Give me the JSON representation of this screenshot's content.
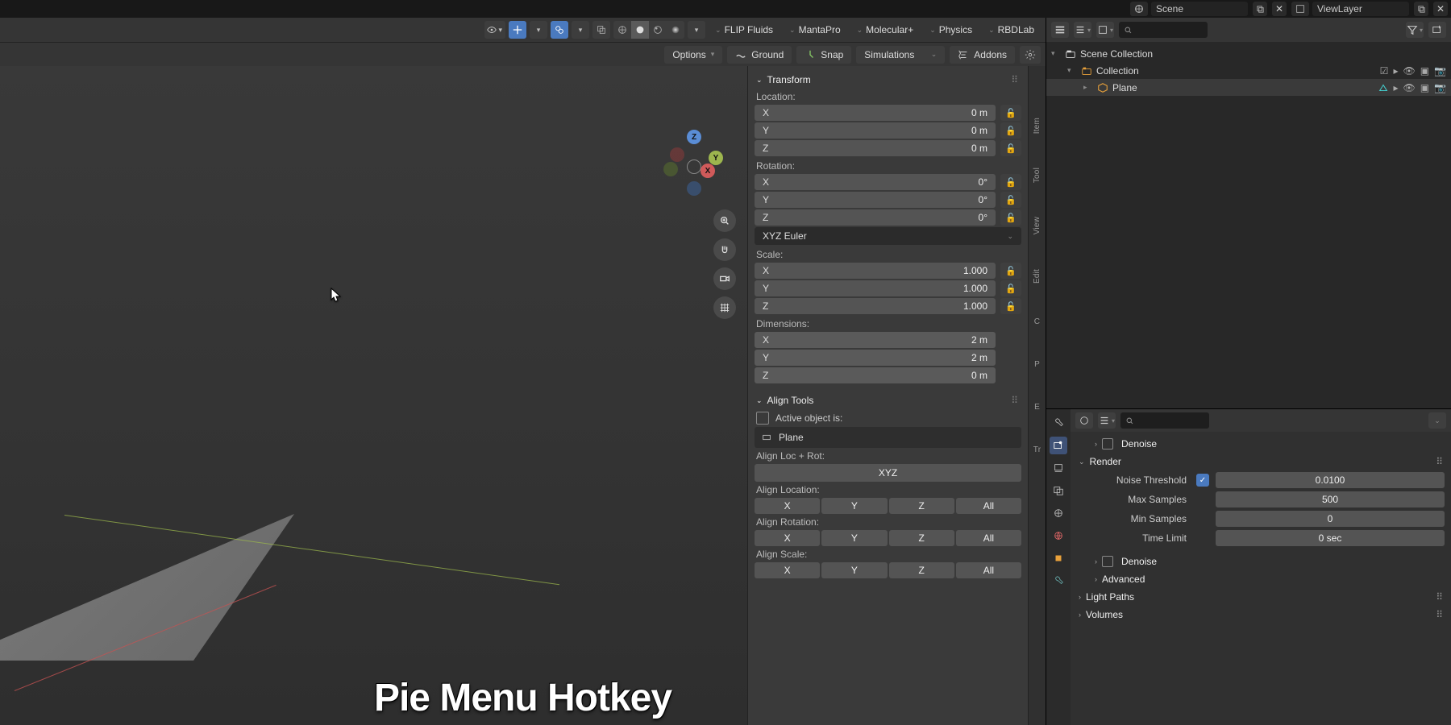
{
  "topbar": {
    "scene_label": "Scene",
    "scene_icon": "scene-icon",
    "layer_label": "ViewLayer",
    "layer_icon": "viewlayer-icon"
  },
  "viewport_header": {
    "menus": [
      "FLIP Fluids",
      "MantaPro",
      "Molecular+",
      "Physics",
      "RBDLab"
    ]
  },
  "viewport_subheader": {
    "options": "Options",
    "ground": "Ground",
    "snap": "Snap",
    "simulations": "Simulations",
    "addons": "Addons"
  },
  "gizmo": {
    "x": "X",
    "y": "Y",
    "z": "Z"
  },
  "npanel": {
    "transform_title": "Transform",
    "location_label": "Location:",
    "rotation_label": "Rotation:",
    "scale_label": "Scale:",
    "dimensions_label": "Dimensions:",
    "rot_mode": "XYZ Euler",
    "loc": {
      "x": "X",
      "xv": "0 m",
      "y": "Y",
      "yv": "0 m",
      "z": "Z",
      "zv": "0 m"
    },
    "rot": {
      "x": "X",
      "xv": "0°",
      "y": "Y",
      "yv": "0°",
      "z": "Z",
      "zv": "0°"
    },
    "scale": {
      "x": "X",
      "xv": "1.000",
      "y": "Y",
      "yv": "1.000",
      "z": "Z",
      "zv": "1.000"
    },
    "dim": {
      "x": "X",
      "xv": "2 m",
      "y": "Y",
      "yv": "2 m",
      "z": "Z",
      "zv": "0 m"
    },
    "align_title": "Align Tools",
    "active_label": "Active object is:",
    "active_object": "Plane",
    "align_locrot": "Align Loc + Rot:",
    "xyz": "XYZ",
    "align_location": "Align Location:",
    "align_rotation": "Align Rotation:",
    "align_scale": "Align Scale:",
    "btns": {
      "x": "X",
      "y": "Y",
      "z": "Z",
      "all": "All"
    }
  },
  "ntabs": [
    "Item",
    "Tool",
    "View",
    "Edit",
    "C",
    "P",
    "E",
    "Tr"
  ],
  "outliner": {
    "scene_collection": "Scene Collection",
    "collection": "Collection",
    "object": "Plane"
  },
  "props": {
    "denoise1": "Denoise",
    "render": "Render",
    "noise_threshold_label": "Noise Threshold",
    "noise_threshold_value": "0.0100",
    "max_samples_label": "Max Samples",
    "max_samples_value": "500",
    "min_samples_label": "Min Samples",
    "min_samples_value": "0",
    "time_limit_label": "Time Limit",
    "time_limit_value": "0 sec",
    "denoise2": "Denoise",
    "advanced": "Advanced",
    "light_paths": "Light Paths",
    "volumes": "Volumes"
  },
  "overlay": "Pie Menu Hotkey"
}
